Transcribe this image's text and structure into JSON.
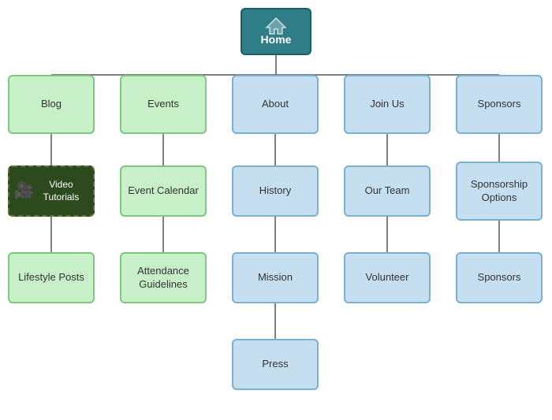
{
  "nodes": {
    "home": "Home",
    "blog": "Blog",
    "events": "Events",
    "about": "About",
    "joinus": "Join Us",
    "sponsors": "Sponsors",
    "video_tutorials": "Video Tutorials",
    "lifestyle_posts": "Lifestyle Posts",
    "event_calendar": "Event Calendar",
    "attendance_guidelines": "Attendance Guidelines",
    "history": "History",
    "mission": "Mission",
    "press": "Press",
    "our_team": "Our Team",
    "volunteer": "Volunteer",
    "sponsorship_options": "Sponsorship Options",
    "sponsors2": "Sponsors"
  }
}
